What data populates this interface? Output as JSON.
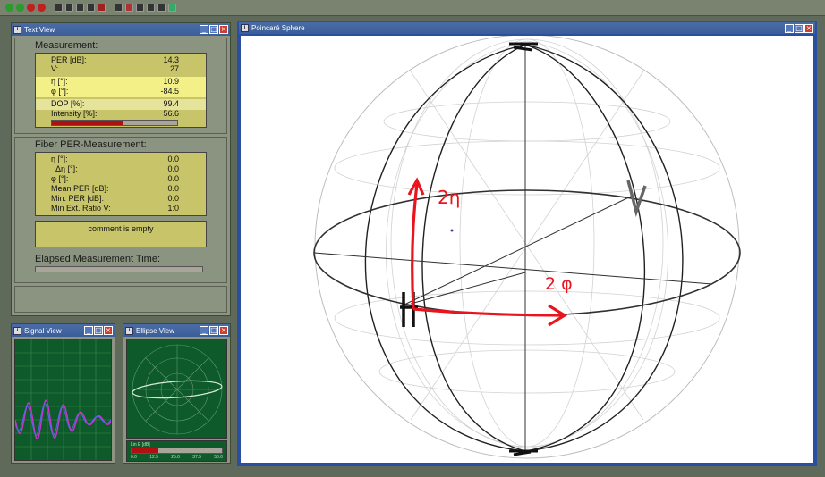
{
  "text_view": {
    "title": "Text View",
    "measurement_title": "Measurement:",
    "rows": [
      {
        "label": "PER [dB]:",
        "value": "14.3"
      },
      {
        "label": "V:",
        "value": "27"
      },
      {
        "label": "η [°]:",
        "value": "10.9"
      },
      {
        "label": "φ [°]:",
        "value": "-84.5"
      },
      {
        "label": "DOP [%]:",
        "value": "99.4"
      },
      {
        "label": "Intensity [%]:",
        "value": "56.6"
      }
    ],
    "intensity_fraction": 0.566,
    "fiber_title": "Fiber PER-Measurement:",
    "fiber_rows": [
      {
        "label": "η [°]:",
        "value": "0.0"
      },
      {
        "label": "Δη [°]:",
        "value": "0.0"
      },
      {
        "label": "φ [°]:",
        "value": "0.0"
      },
      {
        "label": "Mean PER [dB]:",
        "value": "0.0"
      },
      {
        "label": "Min. PER [dB]:",
        "value": "0.0"
      },
      {
        "label": "Min Ext. Ratio V:",
        "value": "1:0"
      }
    ],
    "comment": "comment is empty",
    "elapsed_title": "Elapsed Measurement Time:"
  },
  "signal_view": {
    "title": "Signal View"
  },
  "ellipse_view": {
    "title": "Ellipse View",
    "bar_fraction": 0.3,
    "bar_label": "Lin E [dB]",
    "ticks": [
      "0.0",
      "12.5",
      "25.0",
      "37.5",
      "50.0"
    ]
  },
  "poincare": {
    "title": "Poincaré Sphere",
    "label_eta": "2η",
    "label_phi": "2 φ"
  },
  "colors": {
    "accent_red": "#e8141e",
    "panel_yellow": "#c8c46a",
    "title_blue": "#3b5d98"
  }
}
